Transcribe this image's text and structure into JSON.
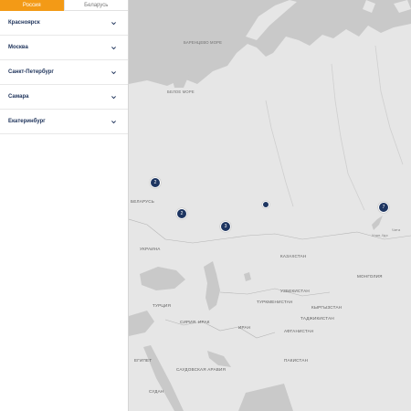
{
  "tabs": [
    {
      "label": "Россия",
      "active": true
    },
    {
      "label": "Беларусь",
      "active": false
    }
  ],
  "cities": [
    {
      "label": "Красноярск"
    },
    {
      "label": "Москва"
    },
    {
      "label": "Санкт-Петербург"
    },
    {
      "label": "Самара"
    },
    {
      "label": "Екатеринбург"
    }
  ],
  "map": {
    "markers": [
      {
        "count": "2"
      },
      {
        "count": "2"
      },
      {
        "count": "3"
      },
      {
        "count": ""
      },
      {
        "count": "7"
      }
    ],
    "labels": {
      "barents": "Баренцево море",
      "white": "Белое море",
      "belarus": "Беларусь",
      "ukraine": "Украина",
      "kazakhstan": "Казахстан",
      "uzbekistan": "Узбекистан",
      "turkmenistan": "Туркменистан",
      "turkey": "Турция",
      "iran": "Иран",
      "iraq": "Ирак",
      "syria": "Сирия",
      "egypt": "Египет",
      "saudi": "Саудовская Аравия",
      "sudan": "Судан",
      "afghanistan": "Афганистан",
      "pakistan": "Пакистан",
      "mongolia": "Монголия",
      "kyrgyzstan": "Кыргызстан",
      "tajikistan": "Таджикистан",
      "ulan_ude": "Улан-Удэ",
      "chita": "Чита"
    },
    "colors": {
      "land": "#e6e6e6",
      "water": "#c9c9c9",
      "marker": "#1d3561"
    }
  }
}
